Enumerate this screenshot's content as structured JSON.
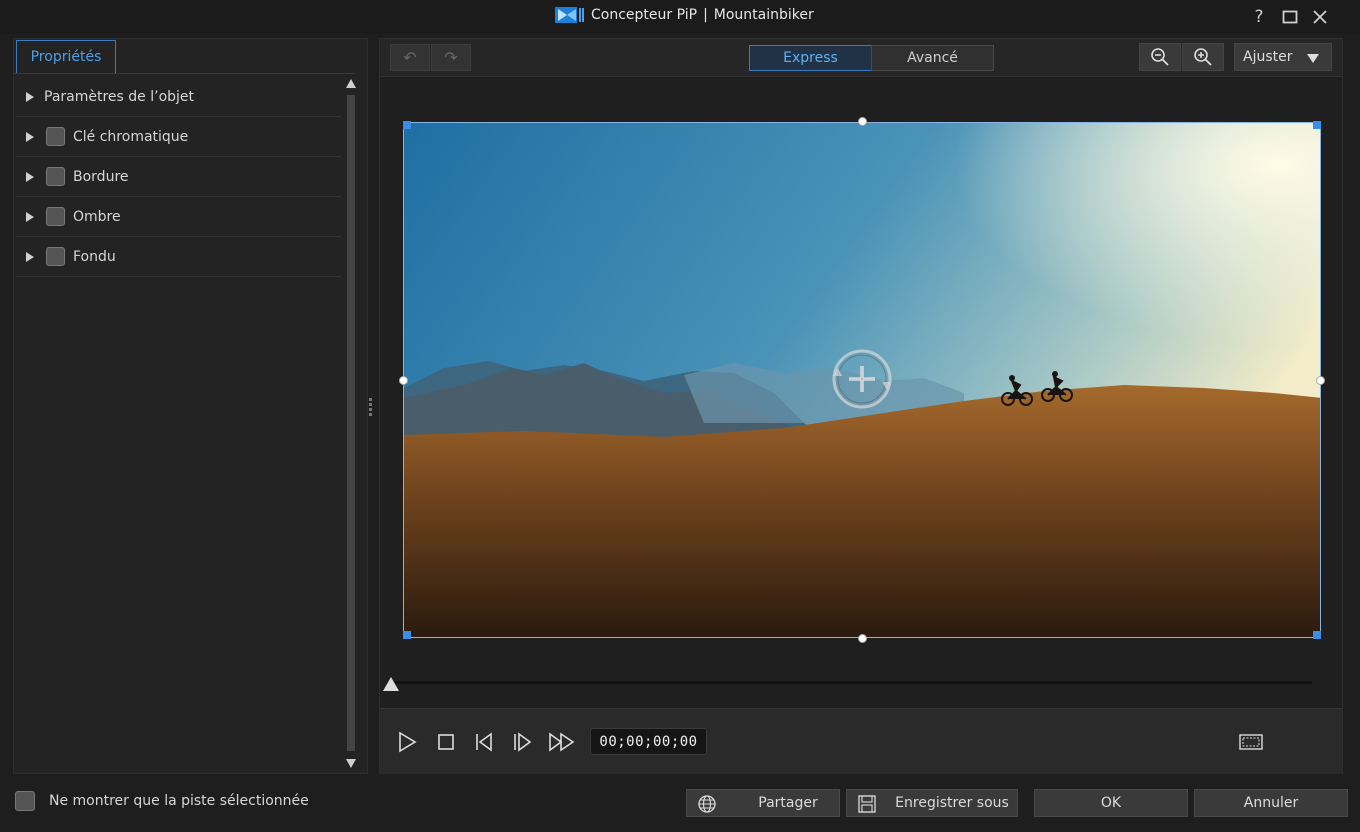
{
  "window": {
    "app_name": "Concepteur PiP",
    "separator": "|",
    "doc_name": "Mountainbiker",
    "help_glyph": "?",
    "maximize_glyph": "☐",
    "close_glyph": "✕"
  },
  "left_panel": {
    "tab_label": "Propriétés",
    "items": [
      {
        "label": "Paramètres de l’objet",
        "has_checkbox": false
      },
      {
        "label": "Clé chromatique",
        "has_checkbox": true
      },
      {
        "label": "Bordure",
        "has_checkbox": true
      },
      {
        "label": "Ombre",
        "has_checkbox": true
      },
      {
        "label": "Fondu",
        "has_checkbox": true
      }
    ]
  },
  "toolbar": {
    "undo_glyph": "↶",
    "redo_glyph": "↷",
    "mode_express": "Express",
    "mode_advanced": "Avancé",
    "active_mode": "Express",
    "fit_label": "Ajuster"
  },
  "transport": {
    "timecode": "00;00;00;00"
  },
  "bottom": {
    "show_selected_track_label": "Ne montrer que la piste sélectionnée",
    "share_label": "Partager",
    "save_as_label": "Enregistrer sous",
    "ok_label": "OK",
    "cancel_label": "Annuler"
  },
  "colors": {
    "accent": "#3a7cc4",
    "accent_text": "#5fb0f2",
    "background": "#1e1e1e"
  }
}
